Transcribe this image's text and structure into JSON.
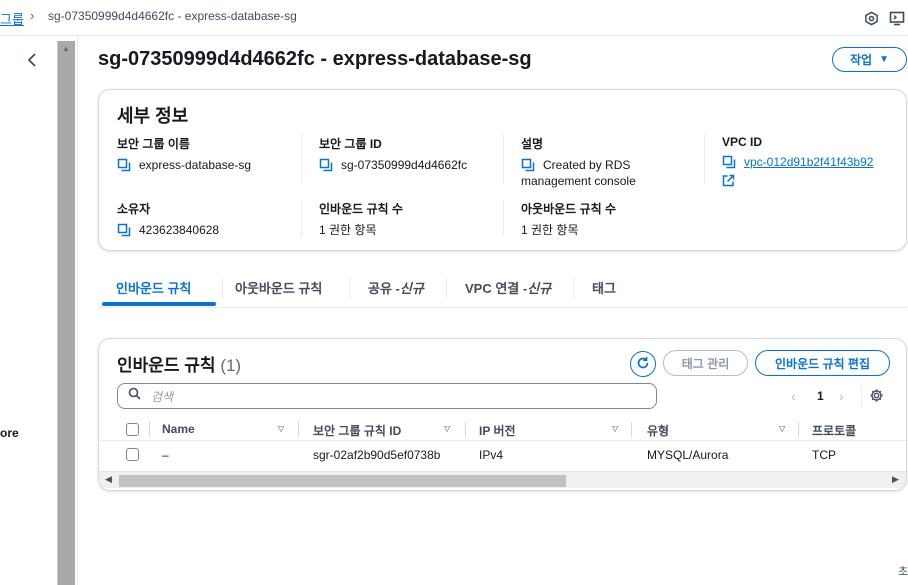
{
  "breadcrumb": {
    "parent_label": "그룹",
    "current_label": "sg-07350999d4d4662fc - express-database-sg"
  },
  "left_nav": {
    "partial_text": "ore"
  },
  "header": {
    "title": "sg-07350999d4d4662fc - express-database-sg",
    "action_label": "작업"
  },
  "details": {
    "title": "세부 정보",
    "fields": {
      "sg_name": {
        "label": "보안 그룹 이름",
        "value": "express-database-sg"
      },
      "sg_id": {
        "label": "보안 그룹 ID",
        "value": "sg-07350999d4d4662fc"
      },
      "description": {
        "label": "설명",
        "value_line1": "Created by RDS",
        "value_line2": "management console"
      },
      "vpc_id": {
        "label": "VPC ID",
        "value": "vpc-012d91b2f41f43b92"
      },
      "owner": {
        "label": "소유자",
        "value": "423623840628"
      },
      "inbound_count": {
        "label": "인바운드 규칙 수",
        "value": "1 권한 항목"
      },
      "outbound_count": {
        "label": "아웃바운드 규칙 수",
        "value": "1 권한 항목"
      }
    }
  },
  "tabs": {
    "inbound": "인바운드 규칙",
    "outbound": "아웃바운드 규칙",
    "sharing": "공유 - ",
    "sharing_new": "신규",
    "vpc": "VPC 연결 - ",
    "vpc_new": "신규",
    "tags": "태그"
  },
  "rules": {
    "title": "인바운드 규칙",
    "count": "(1)",
    "tag_manage_label": "태그 관리",
    "edit_label": "인바운드 규칙 편집",
    "search_placeholder": "검색",
    "page": "1",
    "columns": {
      "name": "Name",
      "rule_id": "보안 그룹 규칙 ID",
      "ip_version": "IP 버전",
      "type": "유형",
      "protocol": "프로토콜"
    },
    "rows": [
      {
        "name": "–",
        "rule_id": "sgr-02af2b90d5ef0738b",
        "ip_version": "IPv4",
        "type": "MYSQL/Aurora",
        "protocol": "TCP"
      }
    ]
  },
  "corner_glyph": "초",
  "colors": {
    "accent": "#0972d3",
    "text": "#16191f",
    "border": "#d5dbdb"
  },
  "icons": [
    "chevron-right-icon",
    "notification-icon",
    "cloudshell-icon",
    "chevron-left-icon",
    "copy-icon",
    "external-link-icon",
    "refresh-icon",
    "search-icon",
    "settings-icon",
    "caret-down-icon",
    "sort-icon"
  ]
}
